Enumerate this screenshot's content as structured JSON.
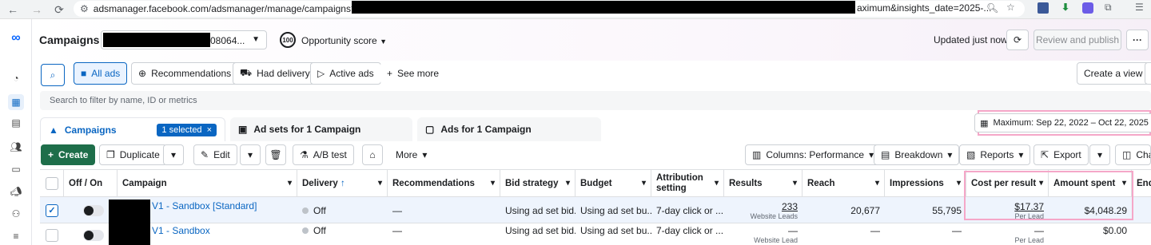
{
  "browser": {
    "url_start": "adsmanager.facebook.com/adsmanager/manage/campaigns?act=",
    "url_end": "aximum&insights_date=2025-..."
  },
  "header": {
    "title": "Campaigns",
    "account_suffix": "08064...",
    "opportunity_badge": "100",
    "opportunity_label": "Opportunity score",
    "updated": "Updated just now",
    "review_publish": "Review and publish",
    "more": "···"
  },
  "filters": {
    "all_ads": "All ads",
    "recommendations": "Recommendations",
    "had_delivery": "Had delivery",
    "active_ads": "Active ads",
    "see_more": "See more",
    "create_view": "Create a view"
  },
  "search": {
    "placeholder": "Search to filter by name, ID or metrics"
  },
  "tabs": {
    "campaigns": "Campaigns",
    "selected": "1 selected",
    "adsets": "Ad sets for 1 Campaign",
    "ads": "Ads for 1 Campaign"
  },
  "date_range": "Maximum: Sep 22, 2022 – Oct 22, 2025",
  "toolbar": {
    "create": "Create",
    "duplicate": "Duplicate",
    "edit": "Edit",
    "ab_test": "A/B test",
    "more": "More",
    "columns": "Columns: Performance",
    "breakdown": "Breakdown",
    "reports": "Reports",
    "export": "Export",
    "charts": "Char"
  },
  "table": {
    "headers": {
      "off_on": "Off / On",
      "campaign": "Campaign",
      "delivery": "Delivery",
      "recommendations": "Recommendations",
      "bid_strategy": "Bid strategy",
      "budget": "Budget",
      "attribution": "Attribution setting",
      "results": "Results",
      "reach": "Reach",
      "impressions": "Impressions",
      "cost_per_result": "Cost per result",
      "amount_spent": "Amount spent",
      "ends": "Ends"
    },
    "rows": [
      {
        "campaign": "V1 - Sandbox [Standard]",
        "delivery": "Off",
        "recommendations": "—",
        "bid_strategy": "Using ad set bid...",
        "budget": "Using ad set bu...",
        "attribution": "7-day click or ...",
        "results": "233",
        "results_sub": "Website Leads",
        "reach": "20,677",
        "impressions": "55,795",
        "cpr": "$17.37",
        "cpr_sub": "Per Lead",
        "spent": "$4,048.29"
      },
      {
        "campaign": "V1 - Sandbox",
        "delivery": "Off",
        "recommendations": "—",
        "bid_strategy": "Using ad set bid...",
        "budget": "Using ad set bu...",
        "attribution": "7-day click or ...",
        "results": "—",
        "results_sub": "Website Lead",
        "reach": "—",
        "impressions": "—",
        "cpr": "—",
        "cpr_sub": "Per Lead",
        "spent": "$0.00"
      }
    ]
  }
}
